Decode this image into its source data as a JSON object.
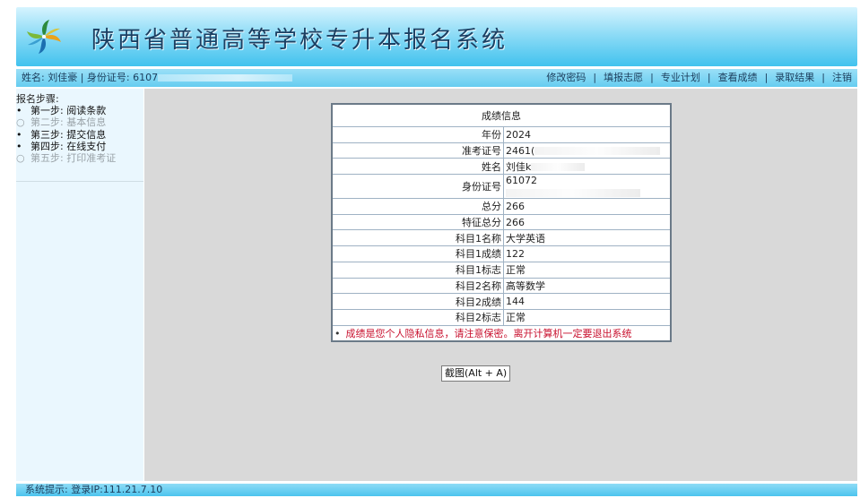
{
  "header": {
    "title": "陕西省普通高等学校专升本报名系统",
    "logo_icon": "pinwheel-logo-icon"
  },
  "userbar": {
    "name_label": "姓名:",
    "name_value": "刘佳豪",
    "id_label": "| 身份证号:",
    "id_value": "6107",
    "nav": [
      "修改密码",
      "填报志愿",
      "专业计划",
      "查看成绩",
      "录取结果",
      "注销"
    ]
  },
  "sidebar": {
    "title": "报名步骤:",
    "steps": [
      {
        "label": "第一步: 阅读条款",
        "active": true
      },
      {
        "label": "第二步: 基本信息",
        "active": false
      },
      {
        "label": "第三步: 提交信息",
        "active": true
      },
      {
        "label": "第四步: 在线支付",
        "active": true
      },
      {
        "label": "第五步: 打印准考证",
        "active": false
      }
    ]
  },
  "score": {
    "header": "成绩信息",
    "rows": [
      {
        "label": "年份",
        "value": "2024"
      },
      {
        "label": "准考证号",
        "value": "2461("
      },
      {
        "label": "姓名",
        "value": "刘佳k"
      },
      {
        "label": "身份证号",
        "value": "61072"
      },
      {
        "label": "总分",
        "value": "266"
      },
      {
        "label": "特征总分",
        "value": "266"
      },
      {
        "label": "科目1名称",
        "value": "大学英语"
      },
      {
        "label": "科目1成绩",
        "value": "122"
      },
      {
        "label": "科目1标志",
        "value": "正常"
      },
      {
        "label": "科目2名称",
        "value": "高等数学"
      },
      {
        "label": "科目2成绩",
        "value": "144"
      },
      {
        "label": "科目2标志",
        "value": "正常"
      }
    ],
    "note": "成绩是您个人隐私信息，请注意保密。离开计算机一定要退出系统"
  },
  "screenshot_button": "截图(Alt + A)",
  "footer": {
    "text": "系统提示: 登录IP:111.21.7.10"
  },
  "colors": {
    "banner": "#41c2ee",
    "note": "#c8102e"
  }
}
